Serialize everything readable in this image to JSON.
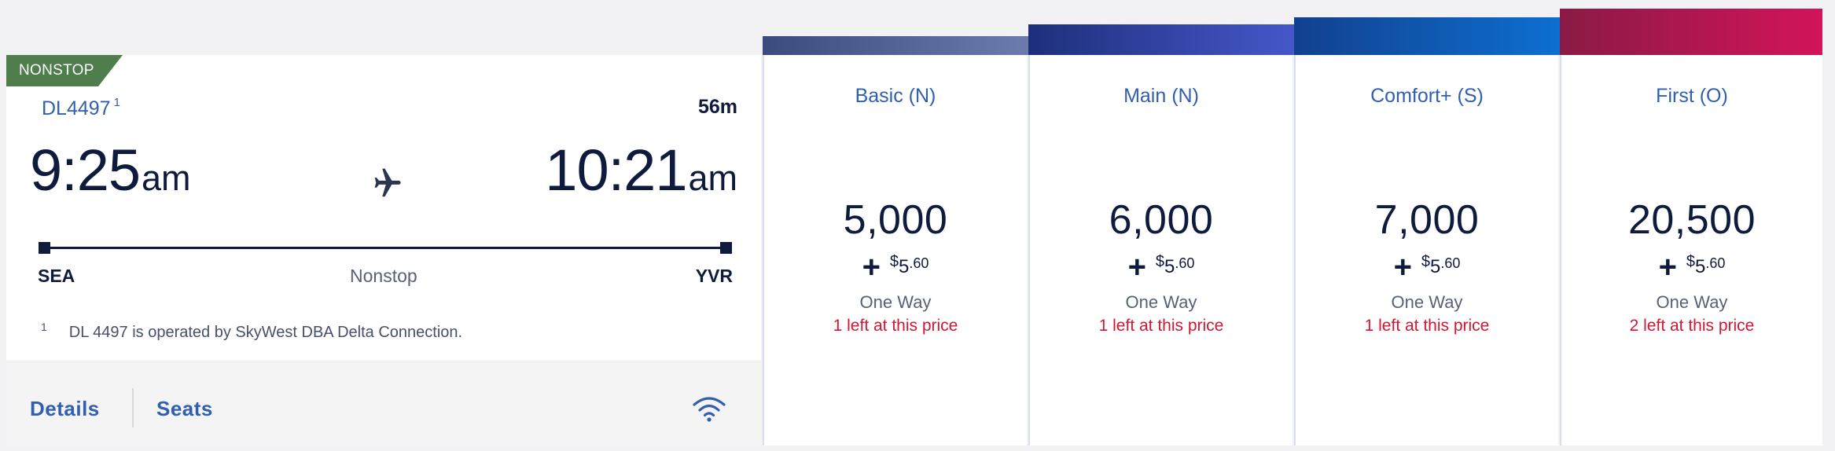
{
  "flight": {
    "badge": "NONSTOP",
    "number": "DL4497",
    "number_footnote_mark": "1",
    "duration": "56m",
    "departure": {
      "time": "9:25",
      "ampm": "am",
      "airport": "SEA"
    },
    "arrival": {
      "time": "10:21",
      "ampm": "am",
      "airport": "YVR"
    },
    "stops": "Nonstop",
    "footnote": {
      "mark": "1",
      "text": "DL 4497 is operated by SkyWest DBA Delta Connection."
    },
    "links": {
      "details": "Details",
      "seats": "Seats"
    },
    "icons": {
      "plane": "plane-icon",
      "wifi": "wifi-icon"
    }
  },
  "fares": [
    {
      "cabin": "Basic (N)",
      "miles": "5,000",
      "plus": "+",
      "currency": "$",
      "taxes": "5",
      "cents": ".60",
      "trip": "One Way",
      "availability": "1 left at this price",
      "header_colors": [
        "#3b4b7e",
        "#6b7bad"
      ]
    },
    {
      "cabin": "Main (N)",
      "miles": "6,000",
      "plus": "+",
      "currency": "$",
      "taxes": "5",
      "cents": ".60",
      "trip": "One Way",
      "availability": "1 left at this price",
      "header_colors": [
        "#1d2f7a",
        "#4557c9"
      ]
    },
    {
      "cabin": "Comfort+ (S)",
      "miles": "7,000",
      "plus": "+",
      "currency": "$",
      "taxes": "5",
      "cents": ".60",
      "trip": "One Way",
      "availability": "1 left at this price",
      "header_colors": [
        "#12408f",
        "#0d6fd0"
      ]
    },
    {
      "cabin": "First (O)",
      "miles": "20,500",
      "plus": "+",
      "currency": "$",
      "taxes": "5",
      "cents": ".60",
      "trip": "One Way",
      "availability": "2 left at this price",
      "header_colors": [
        "#8a1a45",
        "#d3145a"
      ]
    }
  ],
  "colors": {
    "link_blue": "#2f5fae",
    "navy": "#0f1b3d",
    "alert_red": "#d11733",
    "nonstop_green": "#4f7d4c"
  }
}
